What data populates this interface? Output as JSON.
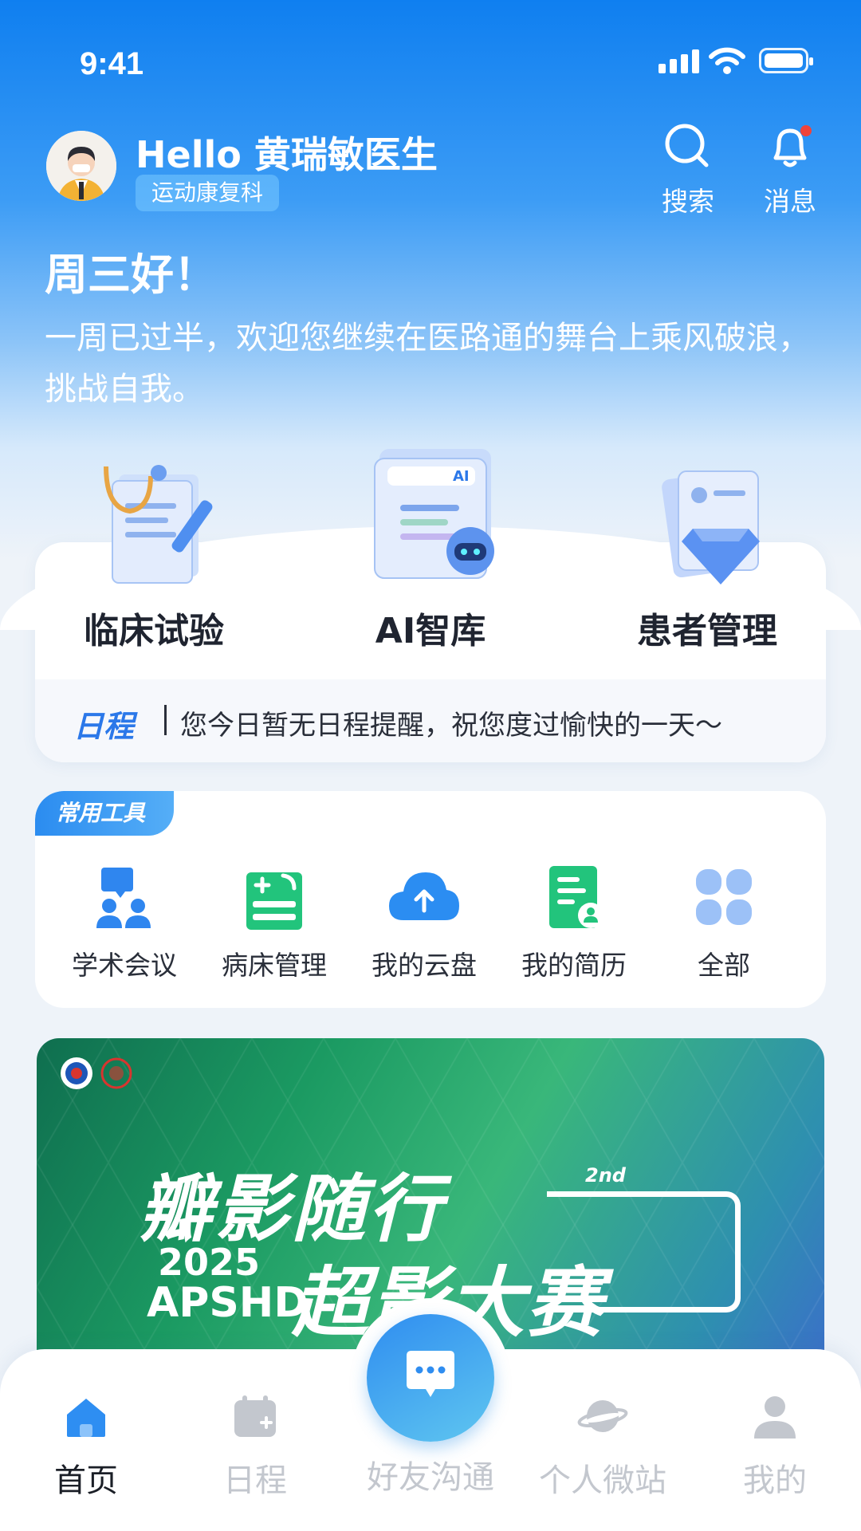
{
  "status_bar": {
    "time": "9:41"
  },
  "header": {
    "greeting": "Hello 黄瑞敏医生",
    "department": "运动康复科",
    "search_label": "搜索",
    "message_label": "消息"
  },
  "welcome": {
    "day_greeting": "周三好！",
    "message": "一周已过半，欢迎您继续在医路通的舞台上乘风破浪，挑战自我。"
  },
  "features": [
    {
      "label": "临床试验",
      "icon": "clinical-trial-icon"
    },
    {
      "label": "AI智库",
      "icon": "ai-library-icon"
    },
    {
      "label": "患者管理",
      "icon": "patient-management-icon"
    }
  ],
  "schedule": {
    "tag": "日程",
    "message": "您今日暂无日程提醒，祝您度过愉快的一天～"
  },
  "tools": {
    "title": "常用工具",
    "items": [
      {
        "label": "学术会议",
        "icon": "academic-meeting-icon"
      },
      {
        "label": "病床管理",
        "icon": "bed-management-icon"
      },
      {
        "label": "我的云盘",
        "icon": "cloud-drive-icon"
      },
      {
        "label": "我的简历",
        "icon": "resume-icon"
      },
      {
        "label": "全部",
        "icon": "all-grid-icon"
      }
    ]
  },
  "banner": {
    "title_top": "瓣影随行",
    "edition": "2nd",
    "year": "2025",
    "org": "APSHD",
    "title_bottom": "超影大赛"
  },
  "tabbar": {
    "items": [
      {
        "label": "首页",
        "icon": "home-icon",
        "active": true
      },
      {
        "label": "日程",
        "icon": "calendar-icon",
        "active": false
      },
      {
        "label": "好友沟通",
        "icon": "chat-icon",
        "active": false
      },
      {
        "label": "个人微站",
        "icon": "planet-icon",
        "active": false
      },
      {
        "label": "我的",
        "icon": "user-icon",
        "active": false
      }
    ]
  },
  "colors": {
    "primary": "#1e88f0",
    "notification_dot": "#f0433a",
    "banner_green": "#1b9a62"
  }
}
